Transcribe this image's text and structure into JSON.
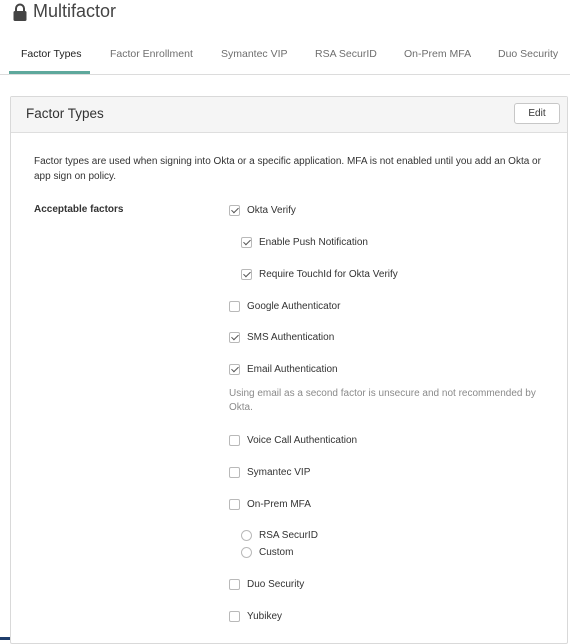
{
  "page": {
    "title": "Multifactor",
    "lock_icon": "lock-icon"
  },
  "tabs": [
    {
      "label": "Factor Types",
      "active": true
    },
    {
      "label": "Factor Enrollment",
      "active": false
    },
    {
      "label": "Symantec VIP",
      "active": false
    },
    {
      "label": "RSA SecurID",
      "active": false
    },
    {
      "label": "On-Prem MFA",
      "active": false
    },
    {
      "label": "Duo Security",
      "active": false
    }
  ],
  "colors": {
    "active_tab_underline": "#5ea89c",
    "panel_header_bg": "#f5f5f5",
    "note_text": "#8a8a8a"
  },
  "panel": {
    "title": "Factor Types",
    "edit_label": "Edit",
    "description": "Factor types are used when signing into Okta or a specific application. MFA is not enabled until you add an Okta or app sign on policy.",
    "acceptable_label": "Acceptable factors",
    "factors": {
      "okta_verify": {
        "label": "Okta Verify",
        "checked": true
      },
      "push": {
        "label": "Enable Push Notification",
        "checked": true
      },
      "touchid": {
        "label": "Require TouchId for Okta Verify",
        "checked": true
      },
      "google_auth": {
        "label": "Google Authenticator",
        "checked": false
      },
      "sms": {
        "label": "SMS Authentication",
        "checked": true
      },
      "email": {
        "label": "Email Authentication",
        "checked": true
      },
      "email_note": "Using email as a second factor is unsecure and not recommended by Okta.",
      "voice": {
        "label": "Voice Call Authentication",
        "checked": false
      },
      "symantec": {
        "label": "Symantec VIP",
        "checked": false
      },
      "onprem": {
        "label": "On-Prem MFA",
        "checked": false
      },
      "rsa": {
        "label": "RSA SecurID",
        "selected": false
      },
      "custom": {
        "label": "Custom",
        "selected": false
      },
      "duo": {
        "label": "Duo Security",
        "checked": false
      },
      "yubikey": {
        "label": "Yubikey",
        "checked": false
      }
    }
  }
}
